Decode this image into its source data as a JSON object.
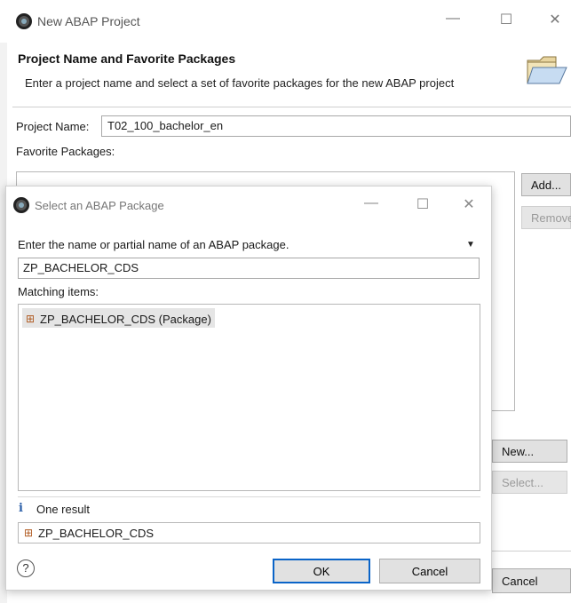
{
  "main_window": {
    "title": "New ABAP Project",
    "minimize": "—",
    "maximize": "☐",
    "close": "✕",
    "banner_title": "Project Name and Favorite Packages",
    "banner_desc": "Enter a project name and select a set of favorite packages for the new ABAP project",
    "project_name_label": "Project Name:",
    "project_name_value": "T02_100_bachelor_en",
    "favorite_packages_label": "Favorite Packages:",
    "buttons": {
      "add": "Add...",
      "remove": "Remove",
      "new": "New...",
      "select": "Select...",
      "cancel": "Cancel"
    }
  },
  "dialog": {
    "title": "Select an ABAP Package",
    "minimize": "—",
    "maximize": "☐",
    "close": "✕",
    "prompt": "Enter the name or partial name of an ABAP package.",
    "search_value": "ZP_BACHELOR_CDS",
    "matching_label": "Matching items:",
    "matching_items": [
      "ZP_BACHELOR_CDS (Package)"
    ],
    "info_text": "One result",
    "result_value": "ZP_BACHELOR_CDS",
    "ok_label": "OK",
    "cancel_label": "Cancel",
    "help_glyph": "?"
  },
  "colors": {
    "accent": "#0a64c8",
    "package_icon": "#b05a20"
  }
}
